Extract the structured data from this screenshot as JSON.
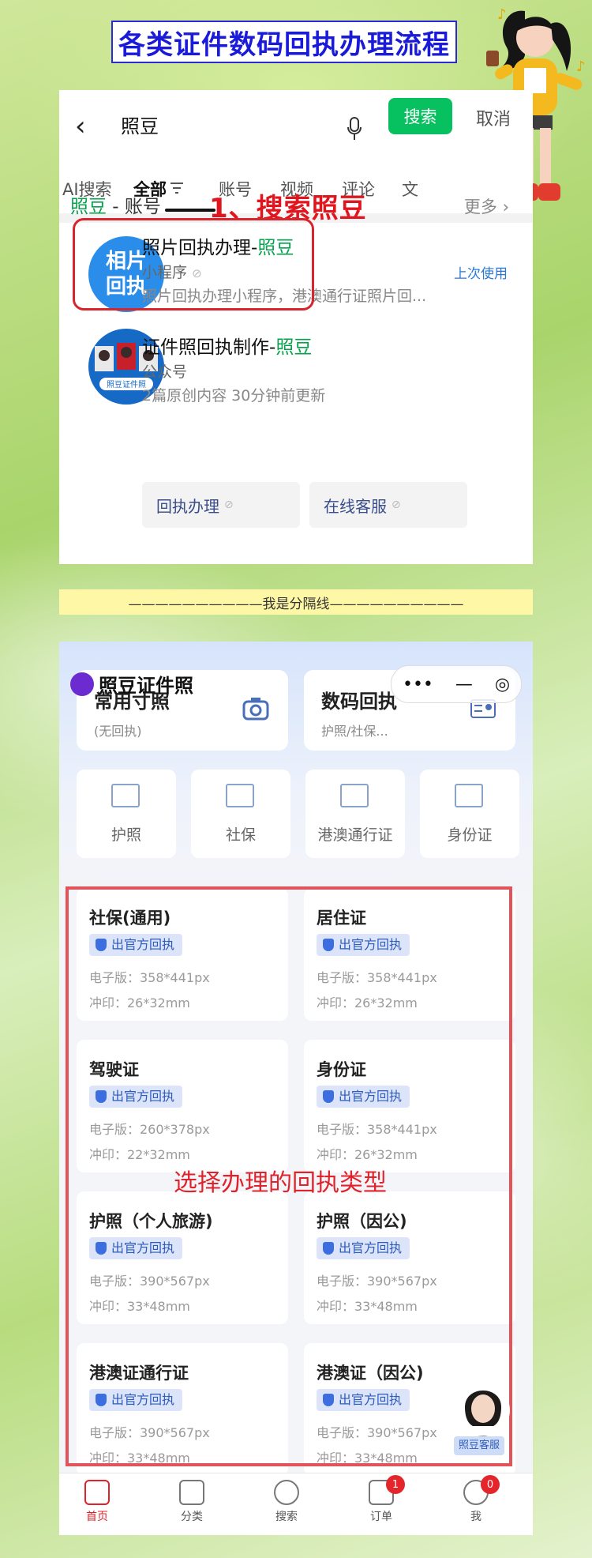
{
  "page_title": "各类证件数码回执办理流程",
  "search_screen": {
    "back_icon": "chevron-left-icon",
    "query": "照豆",
    "search_button": "搜索",
    "cancel_label": "取消",
    "tabs": [
      "AI搜索",
      "全部",
      "账号",
      "视频",
      "评论",
      "文"
    ],
    "active_tab": "全部",
    "account_section": {
      "keyword": "照豆",
      "suffix": " - 账号",
      "more": "更多"
    },
    "step_label": "1、搜索照豆",
    "results": [
      {
        "logo_text": [
          "相片",
          "回执"
        ],
        "title_prefix": "照片回执办理-",
        "title_highlight": "照豆",
        "type": "小程序",
        "desc": "照片回执办理小程序，港澳通行证照片回...",
        "tag": "上次使用"
      },
      {
        "logo_text": [
          "照豆证件照"
        ],
        "title_prefix": "证件照回执制作-",
        "title_highlight": "照豆",
        "type": "公众号",
        "desc": "2篇原创内容  30分钟前更新",
        "buttons": [
          "回执办理",
          "在线客服"
        ]
      }
    ]
  },
  "divider_text": "——————————我是分隔线——————————",
  "miniapp": {
    "title": "照豆证件照",
    "capsule": [
      "•••",
      "—",
      "◎"
    ],
    "features": [
      {
        "title": "常用寸照",
        "sub": "(无回执)"
      },
      {
        "title": "数码回执",
        "sub": "护照/社保..."
      }
    ],
    "categories": [
      "护照",
      "社保",
      "港澳通行证",
      "身份证"
    ],
    "badge_text": "出官方回执",
    "items": [
      {
        "name": "社保(通用)",
        "e": "电子版：358*441px",
        "p": "冲印：26*32mm"
      },
      {
        "name": "居住证",
        "e": "电子版：358*441px",
        "p": "冲印：26*32mm"
      },
      {
        "name": "驾驶证",
        "e": "电子版：260*378px",
        "p": "冲印：22*32mm"
      },
      {
        "name": "身份证",
        "e": "电子版：358*441px",
        "p": "冲印：26*32mm"
      },
      {
        "name": "护照（个人旅游)",
        "e": "电子版：390*567px",
        "p": "冲印：33*48mm"
      },
      {
        "name": "护照（因公)",
        "e": "电子版：390*567px",
        "p": "冲印：33*48mm"
      },
      {
        "name": "港澳证通行证",
        "e": "电子版：390*567px",
        "p": "冲印：33*48mm"
      },
      {
        "name": "港澳证（因公)",
        "e": "电子版：390*567px",
        "p": "冲印：33*48mm"
      }
    ],
    "step_label": "选择办理的回执类型",
    "service_tag": "照豆客服",
    "nav": [
      {
        "label": "首页",
        "badge": ""
      },
      {
        "label": "分类",
        "badge": ""
      },
      {
        "label": "搜索",
        "badge": ""
      },
      {
        "label": "订单",
        "badge": "1"
      },
      {
        "label": "我",
        "badge": "0"
      }
    ]
  }
}
